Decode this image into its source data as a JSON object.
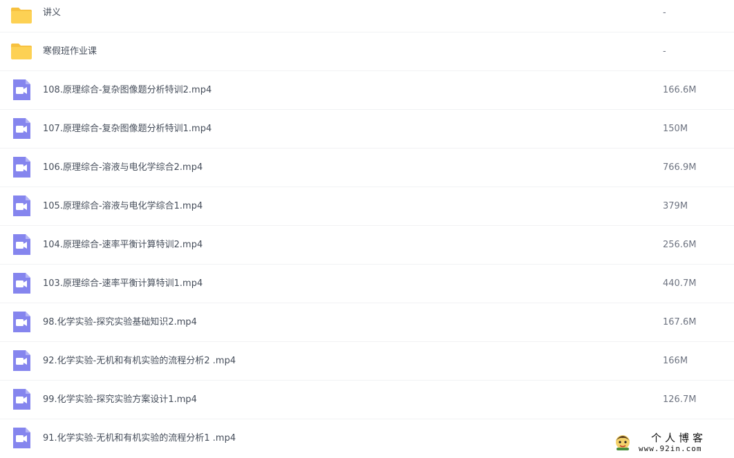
{
  "files": [
    {
      "icon": "folder-icon",
      "name": "讲义",
      "size": "-"
    },
    {
      "icon": "folder-icon",
      "name": "寒假班作业课",
      "size": "-"
    },
    {
      "icon": "video-file-icon",
      "name": "108.原理综合-复杂图像题分析特训2.mp4",
      "size": "166.6M"
    },
    {
      "icon": "video-file-icon",
      "name": "107.原理综合-复杂图像题分析特训1.mp4",
      "size": "150M"
    },
    {
      "icon": "video-file-icon",
      "name": "106.原理综合-溶液与电化学综合2.mp4",
      "size": "766.9M"
    },
    {
      "icon": "video-file-icon",
      "name": "105.原理综合-溶液与电化学综合1.mp4",
      "size": "379M"
    },
    {
      "icon": "video-file-icon",
      "name": "104.原理综合-速率平衡计算特训2.mp4",
      "size": "256.6M"
    },
    {
      "icon": "video-file-icon",
      "name": "103.原理综合-速率平衡计算特训1.mp4",
      "size": "440.7M"
    },
    {
      "icon": "video-file-icon",
      "name": "98.化学实验-探究实验基础知识2.mp4",
      "size": "167.6M"
    },
    {
      "icon": "video-file-icon",
      "name": "92.化学实验-无机和有机实验的流程分析2 .mp4",
      "size": "166M"
    },
    {
      "icon": "video-file-icon",
      "name": "99.化学实验-探究实验方案设计1.mp4",
      "size": "126.7M"
    },
    {
      "icon": "video-file-icon",
      "name": "91.化学实验-无机和有机实验的流程分析1 .mp4",
      "size": ""
    }
  ],
  "watermark": {
    "title": "个人博客",
    "url": "www.92in.com"
  },
  "colors": {
    "folder": "#fdd154",
    "folder_back": "#f7c13f",
    "video": "#8585ee",
    "divider": "#f1f2f4"
  }
}
